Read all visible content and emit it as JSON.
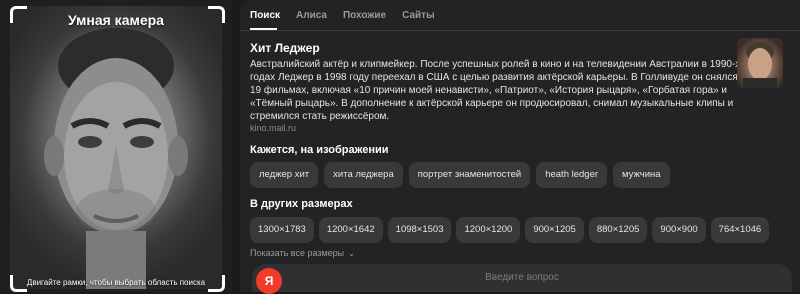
{
  "camera": {
    "title": "Умная камера",
    "hint": "Двигайте рамки, чтобы выбрать область поиска"
  },
  "tabs": [
    {
      "label": "Поиск",
      "active": true
    },
    {
      "label": "Алиса",
      "active": false
    },
    {
      "label": "Похожие",
      "active": false
    },
    {
      "label": "Сайты",
      "active": false
    }
  ],
  "entity": {
    "name": "Хит Леджер",
    "description": "Австралийский актёр и клипмейкер. После успешных ролей в кино и на телевидении Австралии в 1990-х годах Леджер в 1998 году переехал в США с целью развития актёрской карьеры. В Голливуде он снялся в 19 фильмах, включая «10 причин моей ненависти», «Патриот», «История рыцаря», «Горбатая гора» и «Тёмный рыцарь». В дополнение к актёрской карьере он продюсировал, снимал музыкальные клипы и стремился стать режиссёром.",
    "source": "kino.mail.ru"
  },
  "seems": {
    "title": "Кажется, на изображении",
    "chips": [
      "леджер хит",
      "хита леджера",
      "портрет знаменитостей",
      "heath ledger",
      "мужчина"
    ]
  },
  "sizes": {
    "title": "В других размерах",
    "chips": [
      "1300×1783",
      "1200×1642",
      "1098×1503",
      "1200×1200",
      "900×1205",
      "880×1205",
      "900×900",
      "764×1046"
    ],
    "show_all": "Показать все размеры"
  },
  "ask": {
    "placeholder": "Введите вопрос",
    "logo": "Я"
  },
  "colors": {
    "background": "#1a1a1c",
    "panel": "#232325",
    "chip": "#39393b",
    "logo": "#f23a2a"
  }
}
